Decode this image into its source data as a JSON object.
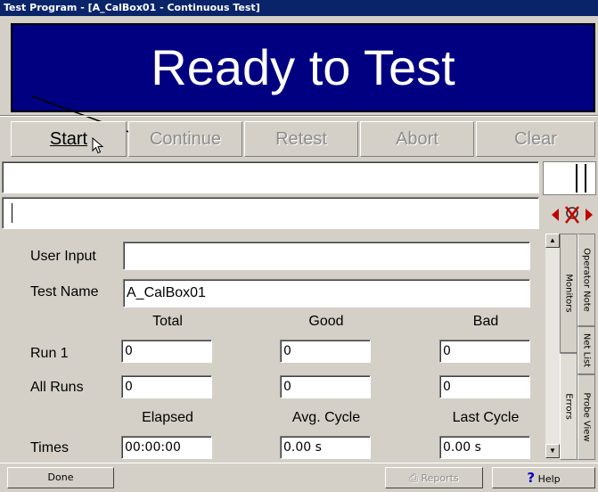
{
  "window": {
    "title": "Test Program - [A_CalBox01 - Continuous Test]"
  },
  "banner": {
    "status": "Ready to Test"
  },
  "toolbar": {
    "start": "Start",
    "continue": "Continue",
    "retest": "Retest",
    "abort": "Abort",
    "clear": "Clear"
  },
  "form": {
    "user_input_label": "User Input",
    "user_input_value": "",
    "test_name_label": "Test Name",
    "test_name_value": "A_CalBox01"
  },
  "stats": {
    "headers": [
      "Total",
      "Good",
      "Bad"
    ],
    "rows": [
      {
        "label": "Run 1",
        "values": [
          "0",
          "0",
          "0"
        ]
      },
      {
        "label": "All Runs",
        "values": [
          "0",
          "0",
          "0"
        ]
      }
    ],
    "time_headers": [
      "Elapsed",
      "Avg. Cycle",
      "Last Cycle"
    ],
    "times_label": "Times",
    "times_values": [
      "00:00:00",
      "0.00 s",
      "0.00 s"
    ]
  },
  "side_tabs": {
    "inner": [
      "Monitors",
      "Errors"
    ],
    "outer": [
      "Operator Note",
      "Net List",
      "Probe View"
    ]
  },
  "footer": {
    "done": "Done",
    "reports": "Reports",
    "help": "Help"
  },
  "colors": {
    "banner_bg": "#000080",
    "titlebar_bg": "#0a246a",
    "face": "#d4d0c8"
  }
}
